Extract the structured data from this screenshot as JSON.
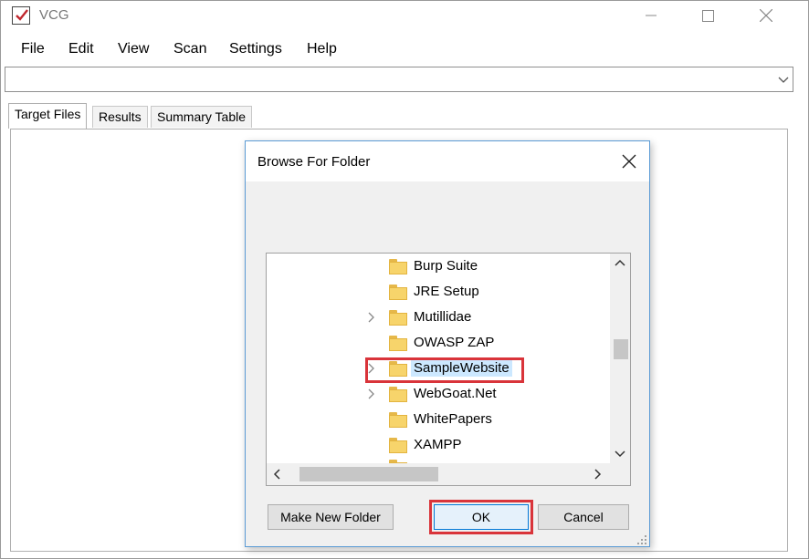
{
  "window": {
    "title": "VCG",
    "icon": "checkbox-check-icon"
  },
  "menu": [
    "File",
    "Edit",
    "View",
    "Scan",
    "Settings",
    "Help"
  ],
  "combo": {
    "value": ""
  },
  "tabs": [
    {
      "label": "Target Files",
      "active": true
    },
    {
      "label": "Results",
      "active": false
    },
    {
      "label": "Summary Table",
      "active": false
    }
  ],
  "dialog": {
    "title": "Browse For Folder",
    "folders": [
      {
        "label": "Burp Suite",
        "expandable": false,
        "selected": false
      },
      {
        "label": "JRE Setup",
        "expandable": false,
        "selected": false
      },
      {
        "label": "Mutillidae",
        "expandable": true,
        "selected": false
      },
      {
        "label": "OWASP ZAP",
        "expandable": false,
        "selected": false
      },
      {
        "label": "SampleWebsite",
        "expandable": true,
        "selected": true
      },
      {
        "label": "WebGoat.Net",
        "expandable": true,
        "selected": false
      },
      {
        "label": "WhitePapers",
        "expandable": false,
        "selected": false
      },
      {
        "label": "XAMPP",
        "expandable": false,
        "selected": false
      }
    ],
    "buttons": {
      "new_folder": "Make New Folder",
      "ok": "OK",
      "cancel": "Cancel"
    }
  },
  "colors": {
    "highlight": "#d9343a",
    "selection": "#cce8ff",
    "dialog_border": "#5b9bd5",
    "folder": "#f7d46b"
  }
}
